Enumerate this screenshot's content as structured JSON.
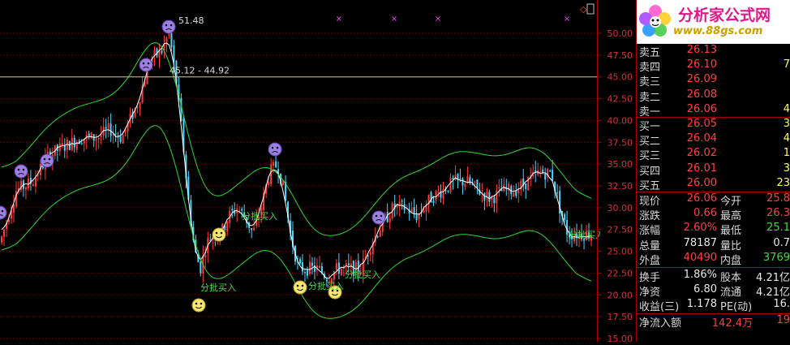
{
  "chart_data": {
    "type": "candlestick",
    "y_ticks": [
      "50.00",
      "47.50",
      "45.00",
      "42.50",
      "40.00",
      "37.50",
      "35.00",
      "32.50",
      "30.00",
      "27.50",
      "25.00",
      "22.50",
      "20.00",
      "17.50",
      "15.00"
    ],
    "ylim": [
      15.0,
      52.5
    ],
    "price_labels": [
      {
        "text": "51.48",
        "price": 51.48
      },
      {
        "text": "45.12 - 44.92",
        "price": 45.0
      }
    ],
    "buy_signals": [
      {
        "text": "分批买入",
        "price": 20.2
      },
      {
        "text": "分批买入",
        "price": 30.0
      },
      {
        "text": "分批买入",
        "price": 20.3
      },
      {
        "text": "分批买入",
        "price": 21.6
      },
      {
        "text": "分批买入",
        "price": 27.3
      }
    ],
    "top_markers": [
      "×",
      "×",
      "×",
      "×"
    ],
    "colors": {
      "up": "#ff3a3a",
      "down": "#4ad7ff",
      "ma": "#ffffff",
      "band": "#2ed82e",
      "axis": "#a00000"
    }
  },
  "logo": {
    "brand": "分析家公式网",
    "url": "www.88gs.com"
  },
  "order_book": [
    {
      "label": "卖五",
      "price": "26.13",
      "vol": ""
    },
    {
      "label": "卖四",
      "price": "26.10",
      "vol": "7"
    },
    {
      "label": "卖三",
      "price": "26.09",
      "vol": ""
    },
    {
      "label": "卖二",
      "price": "26.08",
      "vol": ""
    },
    {
      "label": "卖一",
      "price": "26.06",
      "vol": "4"
    },
    {
      "label": "买一",
      "price": "26.05",
      "vol": "3"
    },
    {
      "label": "买二",
      "price": "26.04",
      "vol": "4"
    },
    {
      "label": "买三",
      "price": "26.02",
      "vol": "1"
    },
    {
      "label": "买四",
      "price": "26.01",
      "vol": "3"
    },
    {
      "label": "买五",
      "price": "26.00",
      "vol": "23"
    }
  ],
  "stats": [
    {
      "l1": "现价",
      "v1": "26.06",
      "l2": "今开",
      "v2": "25.8"
    },
    {
      "l1": "涨跌",
      "v1": "0.66",
      "l2": "最高",
      "v2": "26.3"
    },
    {
      "l1": "涨幅",
      "v1": "2.60%",
      "l2": "最低",
      "v2": "25.1"
    },
    {
      "l1": "总量",
      "v1": "78187",
      "l2": "量比",
      "v2": "0.7"
    },
    {
      "l1": "外盘",
      "v1": "40490",
      "l2": "内盘",
      "v2": "3769"
    }
  ],
  "fundamentals": [
    {
      "l1": "换手",
      "v1": "1.86%",
      "l2": "股本",
      "v2": "4.21亿"
    },
    {
      "l1": "净资",
      "v1": "6.80",
      "l2": "流通",
      "v2": "4.21亿"
    },
    {
      "l1": "收益(三)",
      "v1": "1.178",
      "l2": "PE(动)",
      "v2": "16."
    }
  ],
  "net_inflow": {
    "label": "净流入额",
    "value": "142.4万",
    "extra": "19"
  }
}
